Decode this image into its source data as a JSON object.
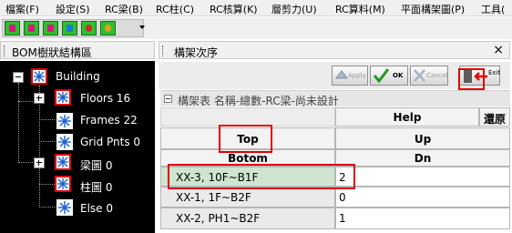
{
  "menubar": {
    "items": [
      "檔案(F)",
      "設定(S)",
      "RC梁(B)",
      "RC柱(C)",
      "RC核算(K)",
      "層剪力(U)",
      "RC算料(M)",
      "平面構架圖(P)",
      "工具("
    ]
  },
  "toolbar": {
    "icons": [
      "beam-tool-icon",
      "column-tool-icon",
      "wall-tool-icon",
      "slab-tool-icon",
      "footing-tool-icon",
      "rebar-tool-icon",
      "dropdown-arrow-icon"
    ],
    "accent_color": "#2fbf2f"
  },
  "left_panel": {
    "title": "BOM樹狀結構區",
    "tree": [
      {
        "label": "Building",
        "expander": "minus",
        "selected": true
      },
      {
        "label": "Floors 16",
        "expander": "plus",
        "selected": true
      },
      {
        "label": "Frames 22",
        "expander": "none",
        "selected": false
      },
      {
        "label": "Grid Pnts 0",
        "expander": "none",
        "selected": false
      },
      {
        "label": "梁圖 0",
        "expander": "plus",
        "selected": true
      },
      {
        "label": "柱圖 0",
        "expander": "none",
        "selected": true
      },
      {
        "label": "Else 0",
        "expander": "none",
        "selected": false
      }
    ],
    "node_icon": "structure-node-icon"
  },
  "right_panel": {
    "title": "構架次序",
    "close_label": "×",
    "buttons": {
      "apply": "Apply",
      "ok": "OK",
      "cancel": "Cancel",
      "exit": "Exit"
    },
    "grid": {
      "caption": "構架表 名稱-總數-RC梁-尚未設計",
      "help": "Help",
      "restore": "還原",
      "top": "Top",
      "up": "Up",
      "bottom": "Botom",
      "down": "Dn",
      "rows": [
        {
          "name": "XX-3, 10F~B1F",
          "value": "2"
        },
        {
          "name": "XX-1, 1F~B2F",
          "value": "0"
        },
        {
          "name": "XX-2, PH1~B2F",
          "value": "1"
        }
      ]
    }
  },
  "colors": {
    "highlight": "#e00000",
    "tree_background": "#000000",
    "selected_row": "#cfe5cf"
  }
}
